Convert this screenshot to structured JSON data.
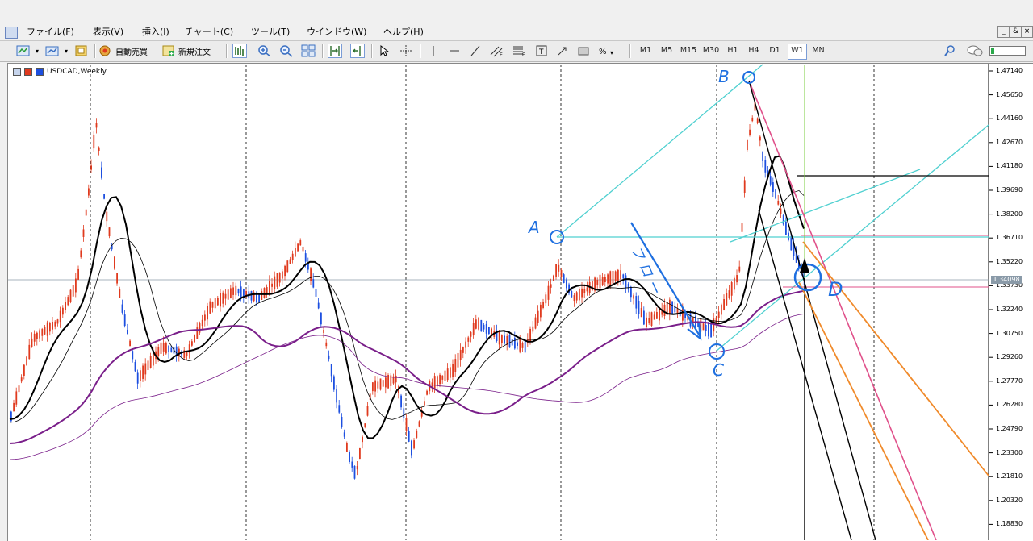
{
  "menu": {
    "items": [
      "ファイル(F)",
      "表示(V)",
      "挿入(I)",
      "チャート(C)",
      "ツール(T)",
      "ウインドウ(W)",
      "ヘルプ(H)"
    ],
    "window_controls": [
      "_",
      "&",
      "×"
    ]
  },
  "toolbar": {
    "auto_trade_label": "自動売買",
    "new_order_label": "新規注文",
    "timeframes": [
      "M1",
      "M5",
      "M15",
      "M30",
      "H1",
      "H4",
      "D1",
      "W1",
      "MN"
    ],
    "active_timeframe": "W1"
  },
  "chart": {
    "title": "USDCAD,Weekly",
    "current_price": "1.34098",
    "price_ticks": [
      "1.47140",
      "1.45650",
      "1.44160",
      "1.42670",
      "1.41180",
      "1.39690",
      "1.38200",
      "1.36710",
      "1.35220",
      "1.33730",
      "1.32240",
      "1.30750",
      "1.29260",
      "1.27770",
      "1.26280",
      "1.24790",
      "1.23300",
      "1.21810",
      "1.20320",
      "1.18830"
    ],
    "annotations": {
      "A": "A",
      "B": "B",
      "C": "C",
      "D": "D",
      "flow_text": "フロー"
    },
    "colors": {
      "up_candle": "#e03a1e",
      "down_candle": "#1d4fe0",
      "ma_fast": "#000000",
      "ma_mid": "#7a1f8a",
      "pitchfork": "#4fd0d0",
      "pen": "#1e6fe0",
      "orange_line": "#f08a2a",
      "pink_line": "#e0508a",
      "green_line": "#7acc3c"
    }
  }
}
